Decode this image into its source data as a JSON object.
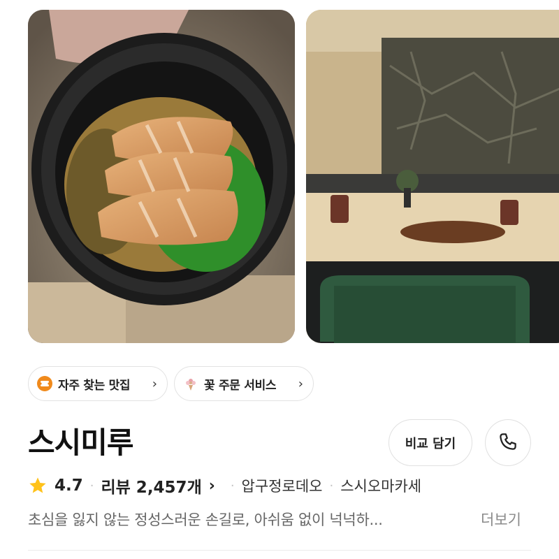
{
  "photos": [
    {
      "icon": "food-photo"
    },
    {
      "icon": "restaurant-interior-photo"
    }
  ],
  "chips": [
    {
      "label": "자주 찾는 맛집",
      "icon": "ticket-icon",
      "color": "#F08A1C"
    },
    {
      "label": "꽃 주문 서비스",
      "icon": "flower-icon",
      "color": "#E8A0A8"
    }
  ],
  "restaurant": {
    "name": "스시미루",
    "compare_label": "비교 담기",
    "rating": "4.7",
    "reviews": "리뷰 2,457개",
    "location": "압구정로데오",
    "category": "스시오마카세",
    "description": "초심을 잃지 않는 정성스러운 손길로, 아쉬움 없이 넉넉하...",
    "more_label": "더보기"
  },
  "colors": {
    "star": "#FFC21A",
    "accent_chip": "#F08A1C"
  }
}
